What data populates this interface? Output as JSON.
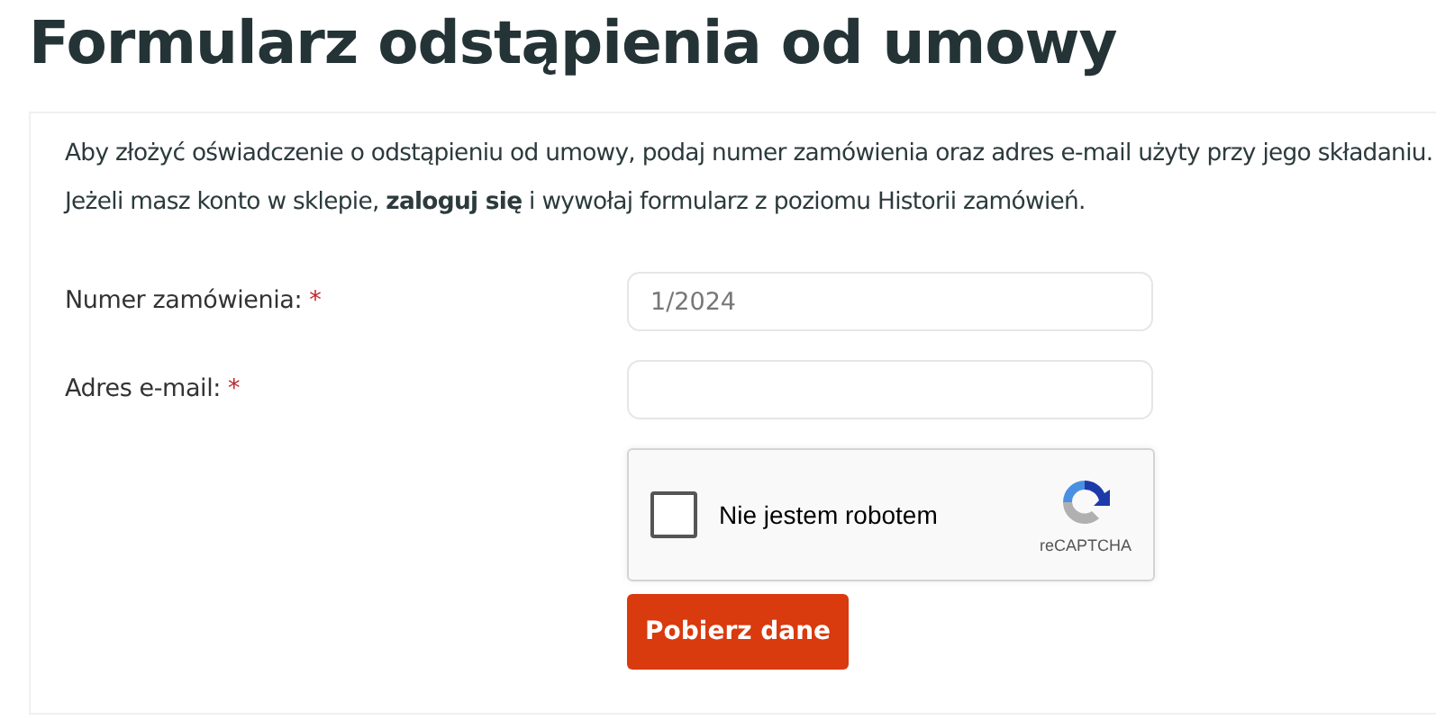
{
  "title": "Formularz odstąpienia od umowy",
  "intro": [
    "Aby złożyć oświadczenie o odstąpieniu od umowy, podaj numer zamówienia oraz adres e-mail użyty przy jego składaniu.",
    "Jeżeli masz konto w sklepie, **zaloguj się** i wywołaj formularz z poziomu Historii zamówień."
  ],
  "fields": [
    {
      "label": "Numer zamówienia:",
      "required_mark": "*",
      "placeholder": "1/2024"
    },
    {
      "label": "Adres e-mail:",
      "required_mark": "*"
    }
  ],
  "captcha": {
    "label": "Nie jestem robotem",
    "brand": "reCAPTCHA",
    "checked": false
  },
  "submit": "Pobierz dane"
}
